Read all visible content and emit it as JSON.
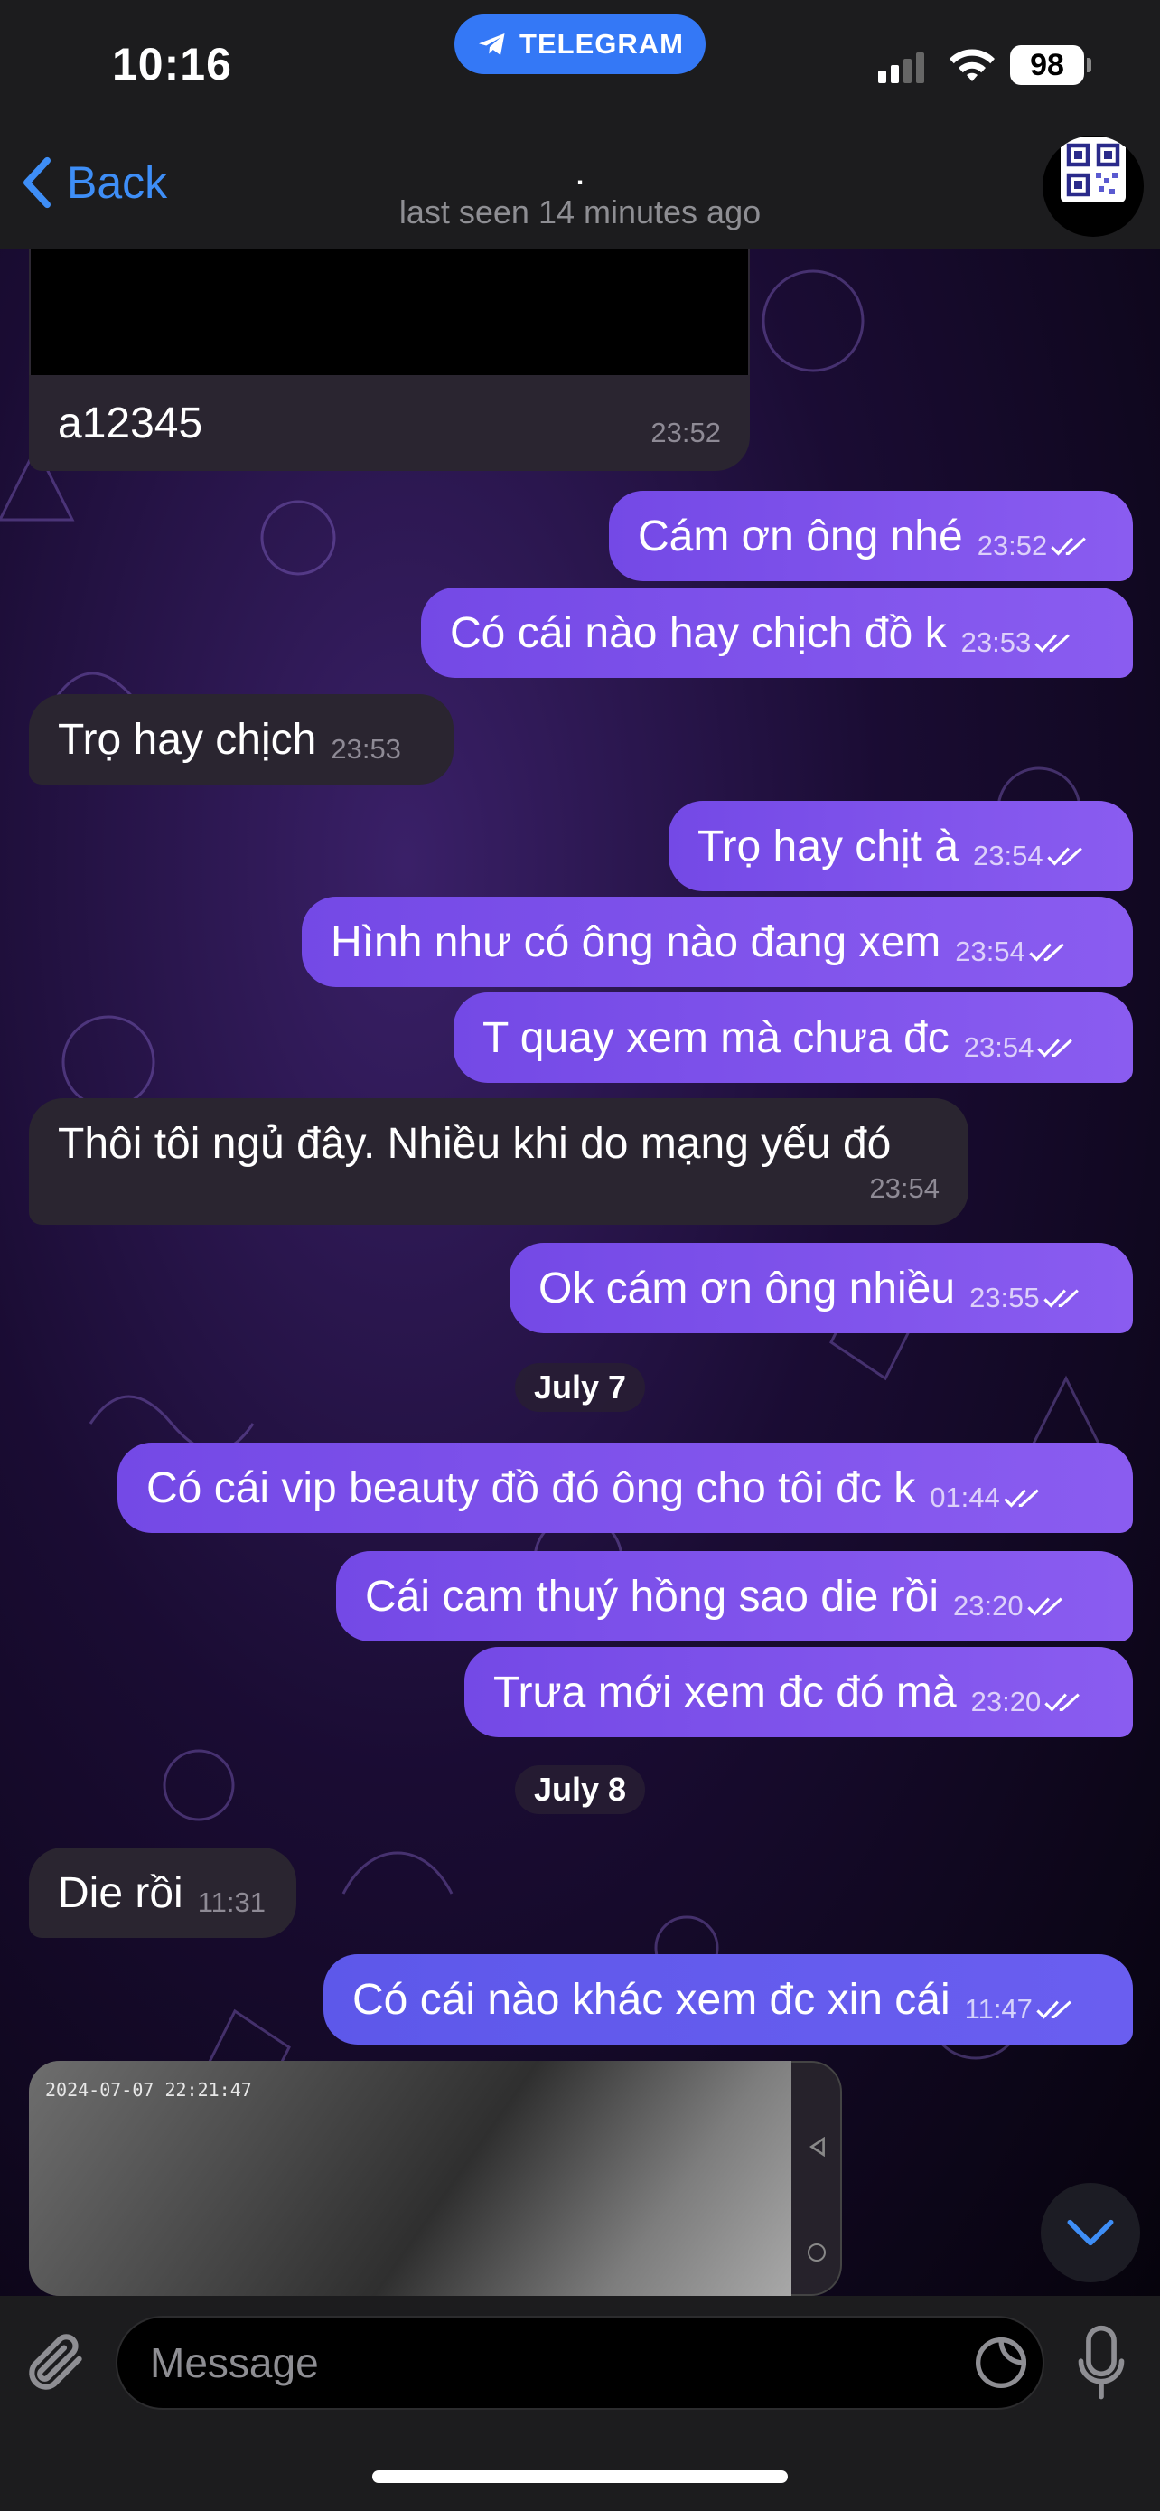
{
  "status_bar": {
    "time": "10:16",
    "app_pill": "TELEGRAM",
    "battery": "98",
    "accent": "#3478f6"
  },
  "header": {
    "back_label": "Back",
    "contact_name": ".",
    "last_seen": "last seen 14 minutes ago",
    "avatar_icon": "qr-code-icon"
  },
  "messages": [
    {
      "dir": "in",
      "text": "a12345",
      "time": "23:52"
    },
    {
      "dir": "out",
      "text": "Cám ơn ông nhé",
      "time": "23:52"
    },
    {
      "dir": "out",
      "text": "Có cái nào hay chịch đồ k",
      "time": "23:53"
    },
    {
      "dir": "in",
      "text": "Trọ hay chịch",
      "time": "23:53"
    },
    {
      "dir": "out",
      "text": "Trọ hay chịt à",
      "time": "23:54"
    },
    {
      "dir": "out",
      "text": "Hình như có ông nào đang xem",
      "time": "23:54"
    },
    {
      "dir": "out",
      "text": "T quay xem mà chưa đc",
      "time": "23:54"
    },
    {
      "dir": "in",
      "text": "Thôi tôi ngủ đây. Nhiều khi do mạng yếu đó",
      "time": "23:54"
    },
    {
      "dir": "out",
      "text": "Ok cám ơn ông nhiều",
      "time": "23:55"
    },
    {
      "dir": "out",
      "text": "Có cái vip beauty đồ đó ông cho tôi đc k",
      "time": "01:44"
    },
    {
      "dir": "out",
      "text": "Cái cam thuý hồng sao die rồi",
      "time": "23:20"
    },
    {
      "dir": "out",
      "text": "Trưa mới xem đc đó mà",
      "time": "23:20"
    },
    {
      "dir": "in",
      "text": "Die rồi",
      "time": "11:31"
    },
    {
      "dir": "out",
      "text": "Có cái nào khác xem đc xin cái",
      "time": "11:47"
    }
  ],
  "date_separators": [
    "July 7",
    "July 8"
  ],
  "video": {
    "timestamp_overlay": "2024-07-07 22:21:47"
  },
  "composer": {
    "placeholder": "Message",
    "value": ""
  },
  "colors": {
    "outgoing_bubble": "#7a4fe8",
    "incoming_bubble": "#2a2530",
    "link_blue": "#3e8ef7"
  }
}
